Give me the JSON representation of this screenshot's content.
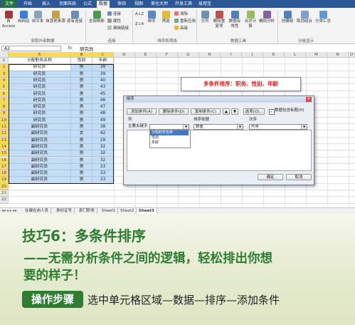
{
  "ribbon": {
    "tabs": [
      "文件",
      "开始",
      "插入",
      "页面布局",
      "公式",
      "数据",
      "审阅",
      "视图",
      "美化大师",
      "开发工具",
      "易用宝"
    ],
    "active_tab": "数据",
    "buttons": {
      "access": "自 Access",
      "web": "自网站",
      "text": "自文本",
      "other_sources": "自其他来源",
      "existing": "现有连接",
      "refresh_all": "全部刷新",
      "connections": "连接",
      "properties": "属性",
      "edit_links": "编辑链接",
      "sort": "排序",
      "filter": "筛选",
      "clear": "清除",
      "reapply": "重新应用",
      "advanced": "高级",
      "text_to_columns": "分列",
      "remove_duplicates": "删除重复项",
      "data_validation": "数据有效性",
      "consolidate": "合并计算",
      "what_if": "模拟分析",
      "group": "创建组",
      "ungroup": "取消组合",
      "subtotal": "分类汇总"
    },
    "groups": [
      "获取外部数据",
      "连接",
      "排序和筛选",
      "数据工具",
      "分级显示"
    ]
  },
  "formula_bar": {
    "name_box": "A2",
    "fx": "fx",
    "value": "研究员"
  },
  "grid": {
    "columns": [
      "A",
      "B",
      "C",
      "D",
      "E",
      "F",
      "G",
      "H",
      "I",
      "J",
      "K",
      "L",
      "M",
      "N",
      "O"
    ],
    "header_row": [
      "分配职务名称",
      "性别",
      "年龄"
    ],
    "rows": [
      [
        "研究员",
        "男",
        "38"
      ],
      [
        "研究员",
        "男",
        "39"
      ],
      [
        "研究员",
        "男",
        "40"
      ],
      [
        "研究员",
        "男",
        "43"
      ],
      [
        "研究员",
        "男",
        "45"
      ],
      [
        "研究员",
        "男",
        "46"
      ],
      [
        "研究员",
        "男",
        "47"
      ],
      [
        "研究员",
        "男",
        "48"
      ],
      [
        "研究员",
        "男",
        "49"
      ],
      [
        "副研究员",
        "男",
        "38"
      ],
      [
        "副研究员",
        "女",
        "42"
      ],
      [
        "副研究员",
        "男",
        "29"
      ],
      [
        "副研究员",
        "男",
        "32"
      ],
      [
        "副研究员",
        "男",
        "32"
      ],
      [
        "副研究员",
        "男",
        "32"
      ],
      [
        "副研究员",
        "男",
        "33"
      ],
      [
        "副研究员",
        "男",
        "33"
      ],
      [
        "副研究员",
        "男",
        "33"
      ]
    ],
    "row_numbers": [
      "1",
      "2",
      "3",
      "4",
      "5",
      "6",
      "7",
      "8",
      "9",
      "10",
      "11",
      "12",
      "13",
      "14",
      "15",
      "16",
      "17",
      "18",
      "19",
      "20",
      "21",
      "22"
    ]
  },
  "sheet_tabs": [
    "在编在岗人员",
    "身份证号",
    "部门职务",
    "Sheet1",
    "Sheet2",
    "Sheet3"
  ],
  "callout": "多条件排序：职务、性别、年龄",
  "dialog": {
    "title": "排序",
    "add_level": "添加条件(A)",
    "delete_level": "删除条件(D)",
    "copy_level": "复制条件(C)",
    "options": "选项(O)...",
    "has_headers": "数据包含标题(H)",
    "col_header": "列",
    "sort_on_header": "排序依据",
    "order_header": "次序",
    "primary_key": "主要关键字",
    "sort_on_value": "数值",
    "order_value": "升序",
    "list_items": [
      "分配职务名称",
      "性别",
      "年龄"
    ],
    "ok": "确定",
    "cancel": "取消"
  },
  "banner": {
    "title": "技巧6：多条件排序",
    "subtitle_line1": "——无需分析条件之间的逻辑，轻松排出你想",
    "subtitle_line2": "要的样子！",
    "steps_label": "操作步骤",
    "steps_text": "选中单元格区域—数据—排序—添加条件"
  },
  "colors": {
    "ribbon_blue": "#2b5797",
    "file_green": "#1e7145",
    "selection_blue": "#c5dcf5",
    "header_yellow": "#f7d95c",
    "callout_red": "#e0201b",
    "banner_green": "#2e7d32"
  }
}
